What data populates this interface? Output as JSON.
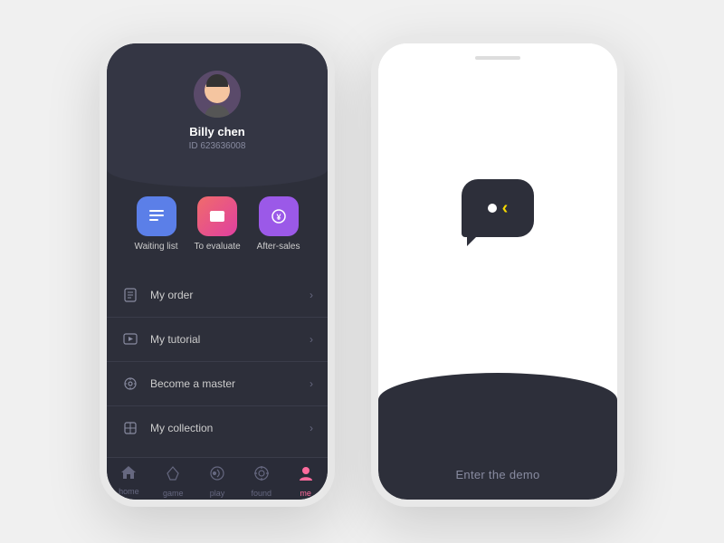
{
  "left_phone": {
    "profile": {
      "name": "Billy chen",
      "id": "ID 623636008"
    },
    "quick_actions": [
      {
        "label": "Waiting list",
        "color_class": "blue",
        "icon": "☰"
      },
      {
        "label": "To evaluate",
        "color_class": "pink",
        "icon": "✉"
      },
      {
        "label": "After-sales",
        "color_class": "purple",
        "icon": "¥"
      }
    ],
    "menu_items": [
      {
        "label": "My order",
        "icon": "⊟"
      },
      {
        "label": "My tutorial",
        "icon": "▷"
      },
      {
        "label": "Become a master",
        "icon": "⚙"
      },
      {
        "label": "My collection",
        "icon": "◈"
      }
    ],
    "nav_items": [
      {
        "label": "home",
        "icon": "⌂",
        "active": false
      },
      {
        "label": "game",
        "icon": "⬡",
        "active": false
      },
      {
        "label": "play",
        "icon": "◈",
        "active": false
      },
      {
        "label": "found",
        "icon": "◎",
        "active": false
      },
      {
        "label": "me",
        "icon": "◉",
        "active": true
      }
    ]
  },
  "right_phone": {
    "enter_demo_label": "Enter the demo"
  }
}
